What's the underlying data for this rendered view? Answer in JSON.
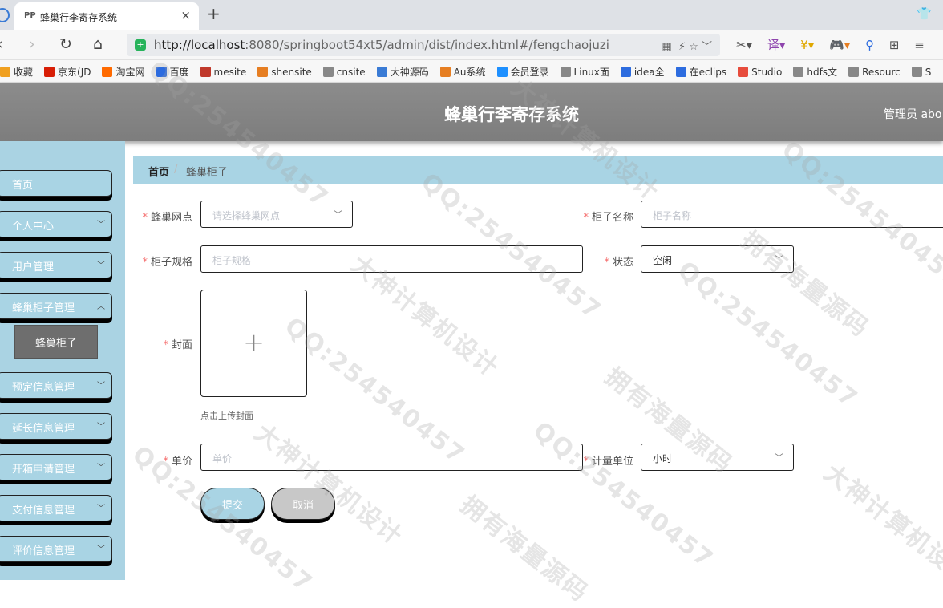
{
  "browser": {
    "tab_title": "蜂巢行李寄存系统",
    "tab_favicon": "PP",
    "close_glyph": "×",
    "newtab_glyph": "+",
    "url_host": "http://localhost",
    "url_rest": ":8080/springboot54xt5/admin/dist/index.html#/fengchaojuzi",
    "bookmarks": [
      "收藏",
      "京东(JD",
      "淘宝网",
      "百度",
      "mesite",
      "shensite",
      "cnsite",
      "大神源码",
      "Au系统",
      "会员登录",
      "Linux面",
      "idea全",
      "在eclips",
      "Studio",
      "hdfs文",
      "Resourc",
      "S"
    ],
    "bookmark_colors": [
      "#f0a020",
      "#d81e06",
      "#ff6a00",
      "#2d6cdf",
      "#c0392b",
      "#e67e22",
      "#888888",
      "#3a7bd5",
      "#e67e22",
      "#1e90ff",
      "#888888",
      "#2d6cdf",
      "#2d6cdf",
      "#e74c3c",
      "#888888",
      "#888888",
      "#888888"
    ]
  },
  "header": {
    "title": "蜂巢行李寄存系统",
    "user": "管理员 abo"
  },
  "sidebar": {
    "items": [
      {
        "label": "首页"
      },
      {
        "label": "个人中心"
      },
      {
        "label": "用户管理"
      },
      {
        "label": "蜂巢柜子管理"
      },
      {
        "label": "预定信息管理"
      },
      {
        "label": "延长信息管理"
      },
      {
        "label": "开箱申请管理"
      },
      {
        "label": "支付信息管理"
      },
      {
        "label": "评价信息管理"
      }
    ],
    "subitem": "蜂巢柜子",
    "chevron_glyph": "﹀"
  },
  "breadcrumb": {
    "home": "首页",
    "separator": "/",
    "current": "蜂巢柜子"
  },
  "form": {
    "required_mark": "*",
    "site_label": "蜂巢网点",
    "site_placeholder": "请选择蜂巢网点",
    "name_label": "柜子名称",
    "name_placeholder": "柜子名称",
    "spec_label": "柜子规格",
    "spec_placeholder": "柜子规格",
    "status_label": "状态",
    "status_value": "空闲",
    "cover_label": "封面",
    "upload_glyph": "+",
    "upload_hint": "点击上传封面",
    "price_label": "单价",
    "price_placeholder": "单价",
    "unit_label": "计量单位",
    "unit_value": "小时",
    "submit": "提交",
    "cancel": "取消"
  },
  "watermarks": [
    "QQ:254540457",
    "大神计算机设计",
    "拥有海量源码"
  ],
  "colors": {
    "sidebar_bg": "#aad3e3",
    "header_bg": "#858585",
    "required": "#f56c6c",
    "cancel_bg": "#c8c8c8"
  }
}
